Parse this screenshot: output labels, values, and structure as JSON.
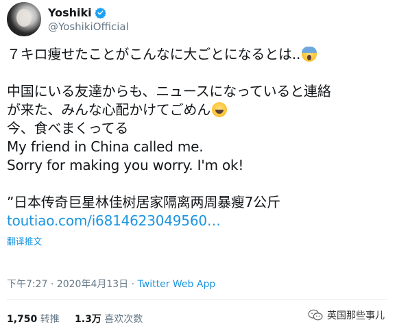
{
  "author": {
    "display_name": "Yoshiki",
    "handle": "@YoshikiOfficial",
    "verified": true,
    "avatar_icon": "avatar-photo"
  },
  "tweet": {
    "line1": "７キロ痩せたことがこんなに大ごとになるとは..",
    "line1_emoji": "face-screaming-in-fear",
    "line2": "中国にいる友達からも、ニュースになっていると連絡",
    "line3": "が来た、みんな心配かけてごめん",
    "line3_emoji": "grinning-squinting-face",
    "line4": "今、食べまくってる",
    "line5": "My friend in China called me.",
    "line6": "Sorry for making you worry. I'm ok!",
    "line7": "”日本传奇巨星林佳树居家隔离两周暴瘦7公斤",
    "link_text": "toutiao.com/i6814623049560…",
    "translate_label": "翻译推文"
  },
  "meta": {
    "time": "下午7:27",
    "separator1": " · ",
    "date": "2020年4月13日",
    "separator2": " · ",
    "source": "Twitter Web App"
  },
  "stats": {
    "retweet_count": "1,750",
    "retweet_label": "转推",
    "like_count": "1.3万",
    "like_label": "喜欢次数"
  },
  "watermark": {
    "label": "英国那些事儿",
    "icon": "wechat-icon"
  },
  "colors": {
    "link": "#1b95e0",
    "verified": "#1da1f2",
    "secondary_text": "#657786",
    "divider": "#e6ecf0"
  }
}
